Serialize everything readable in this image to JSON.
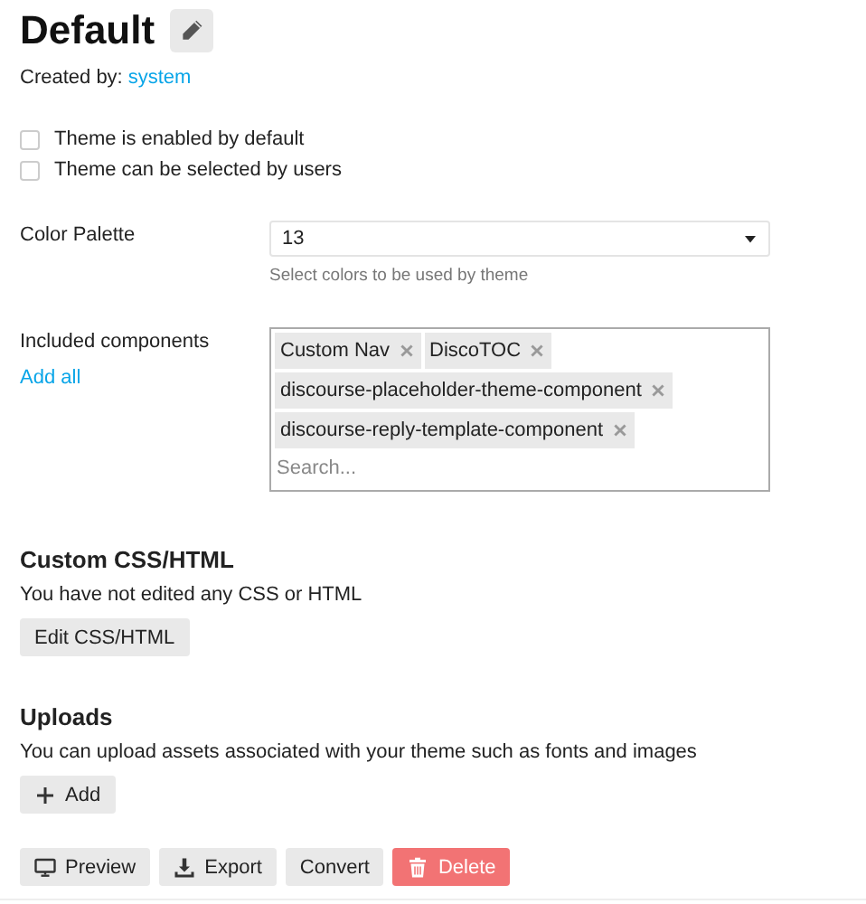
{
  "title": "Default",
  "created_by": {
    "label": "Created by:",
    "user": "system"
  },
  "options": [
    {
      "label": "Theme is enabled by default",
      "checked": false
    },
    {
      "label": "Theme can be selected by users",
      "checked": false
    }
  ],
  "color_palette": {
    "label": "Color Palette",
    "value": "13",
    "hint": "Select colors to be used by theme"
  },
  "components": {
    "label": "Included components",
    "add_all": "Add all",
    "placeholder": "Search...",
    "items": [
      {
        "name": "Custom Nav"
      },
      {
        "name": "DiscoTOC"
      },
      {
        "name": "discourse-placeholder-theme-component"
      },
      {
        "name": "discourse-reply-template-component"
      }
    ]
  },
  "custom_css": {
    "heading": "Custom CSS/HTML",
    "text": "You have not edited any CSS or HTML",
    "button": "Edit CSS/HTML"
  },
  "uploads": {
    "heading": "Uploads",
    "text": "You can upload assets associated with your theme such as fonts and images",
    "button": "Add"
  },
  "actions": [
    {
      "label": "Preview",
      "kind": "preview"
    },
    {
      "label": "Export",
      "kind": "export"
    },
    {
      "label": "Convert",
      "kind": "plain"
    },
    {
      "label": "Delete",
      "kind": "danger"
    }
  ]
}
